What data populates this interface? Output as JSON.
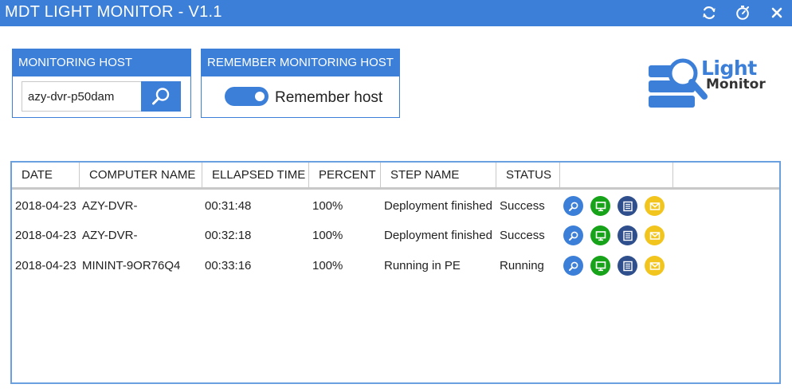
{
  "window": {
    "title": "MDT LIGHT MONITOR - V1.1",
    "controls": [
      "refresh-icon",
      "timer-icon",
      "close-icon"
    ]
  },
  "monitoring_host": {
    "header": "MONITORING HOST",
    "value": "azy-dvr-p50dam",
    "search_icon": "search-icon"
  },
  "remember_host": {
    "header": "REMEMBER MONITORING HOST",
    "toggle_label": "Remember host",
    "toggle_on": true
  },
  "logo": {
    "line1": "Light",
    "line2": "Monitor"
  },
  "table": {
    "columns": [
      "DATE",
      "COMPUTER NAME",
      "ELLAPSED TIME",
      "PERCENT",
      "STEP NAME",
      "STATUS",
      "",
      ""
    ],
    "rows": [
      {
        "date": "2018-04-23",
        "computer": "AZY-DVR-",
        "elapsed": "00:31:48",
        "percent": "100%",
        "step": "Deployment finished",
        "status": "Success"
      },
      {
        "date": "2018-04-23",
        "computer": "AZY-DVR-",
        "elapsed": "00:32:18",
        "percent": "100%",
        "step": "Deployment finished",
        "status": "Success"
      },
      {
        "date": "2018-04-23",
        "computer": "MININT-9OR76Q4",
        "elapsed": "00:33:16",
        "percent": "100%",
        "step": "Running in PE",
        "status": "Running"
      }
    ],
    "row_actions": [
      {
        "icon": "search-icon",
        "color": "#3c7fd8"
      },
      {
        "icon": "monitor-icon",
        "color": "#17a319"
      },
      {
        "icon": "log-icon",
        "color": "#2f4f8c"
      },
      {
        "icon": "mail-icon",
        "color": "#f2c51e"
      }
    ]
  },
  "colors": {
    "accent": "#3c7fd8",
    "success_green": "#17a319",
    "navy": "#2f4f8c",
    "yellow": "#f2c51e"
  }
}
